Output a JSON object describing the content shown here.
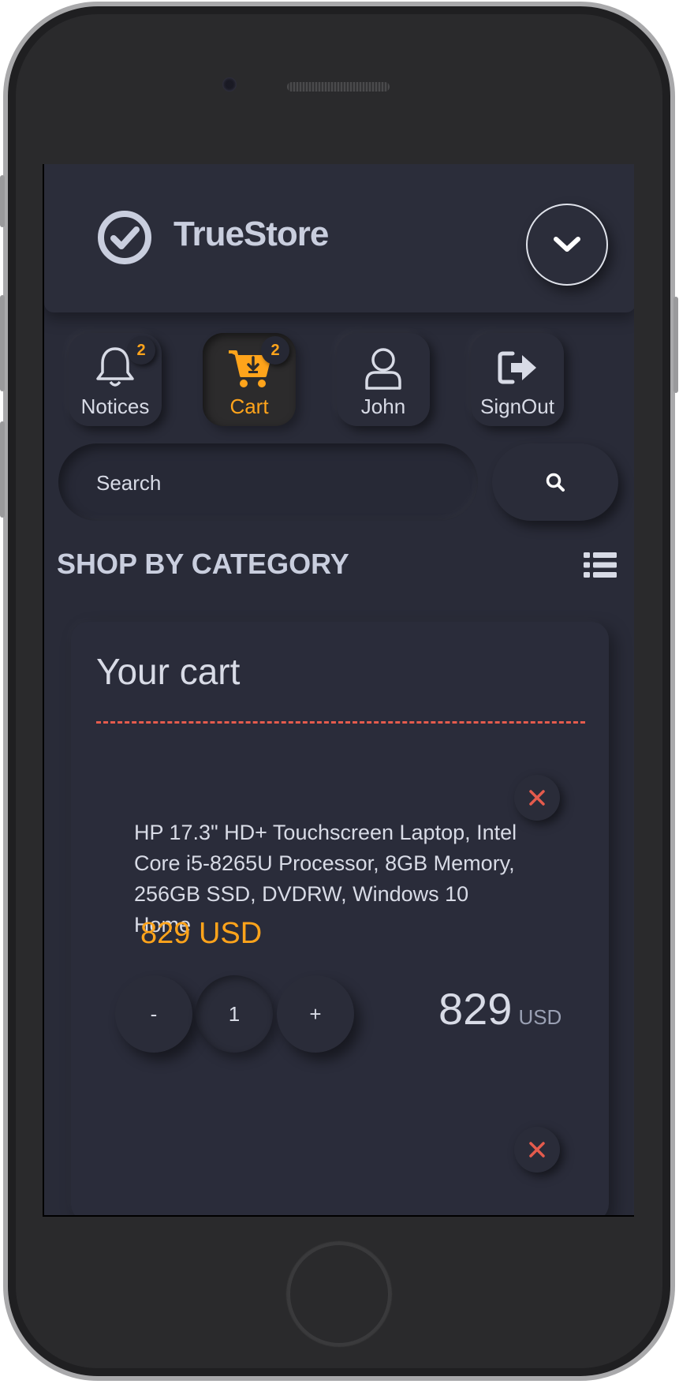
{
  "app": {
    "brand": "TrueStore"
  },
  "nav": [
    {
      "label": "Notices",
      "icon": "bell-icon",
      "badge": "2"
    },
    {
      "label": "Cart",
      "icon": "cart-icon",
      "badge": "2",
      "active": true
    },
    {
      "label": "John",
      "icon": "user-icon"
    },
    {
      "label": "SignOut",
      "icon": "sign-out-icon"
    }
  ],
  "search": {
    "placeholder": "Search"
  },
  "category": {
    "title": "SHOP BY CATEGORY"
  },
  "cart": {
    "title": "Your cart",
    "items": [
      {
        "name": "HP 17.3\" HD+ Touchscreen Laptop, Intel Core i5-8265U Processor, 8GB Memory, 256GB SSD, DVDRW, Windows 10 Home",
        "price": "829 USD",
        "quantity": "1",
        "minus_label": "-",
        "plus_label": "+",
        "total": "829",
        "total_currency": "USD"
      }
    ]
  },
  "colors": {
    "accent": "#ffa41b",
    "background": "#292b38",
    "remove": "#e55b4d"
  }
}
